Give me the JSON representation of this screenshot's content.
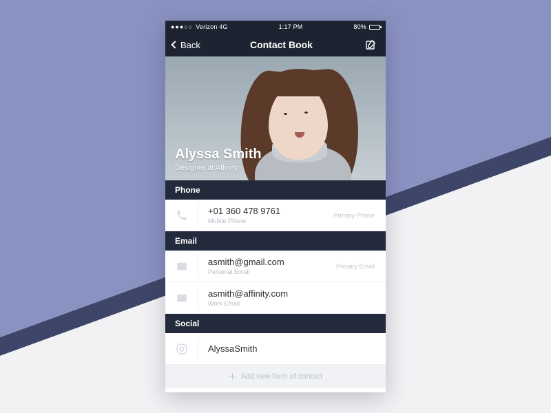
{
  "statusbar": {
    "carrier": "Verizon 4G",
    "time": "1:17 PM",
    "battery_pct": "80%"
  },
  "nav": {
    "back_label": "Back",
    "title": "Contact Book"
  },
  "contact": {
    "name": "Alyssa Smith",
    "subtitle": "Designer at Affinity"
  },
  "sections": {
    "phone": {
      "header": "Phone",
      "rows": [
        {
          "value": "+01 360 478 9761",
          "sub": "Mobile Phone",
          "badge": "Primary Phone"
        }
      ]
    },
    "email": {
      "header": "Email",
      "rows": [
        {
          "value": "asmith@gmail.com",
          "sub": "Personal Email",
          "badge": "Primary Email"
        },
        {
          "value": "asmith@affinity.com",
          "sub": "Work Email",
          "badge": ""
        }
      ]
    },
    "social": {
      "header": "Social",
      "rows": [
        {
          "value": "AlyssaSmith",
          "sub": "",
          "badge": ""
        }
      ]
    }
  },
  "footer": {
    "add_label": "Add new form of contact"
  }
}
